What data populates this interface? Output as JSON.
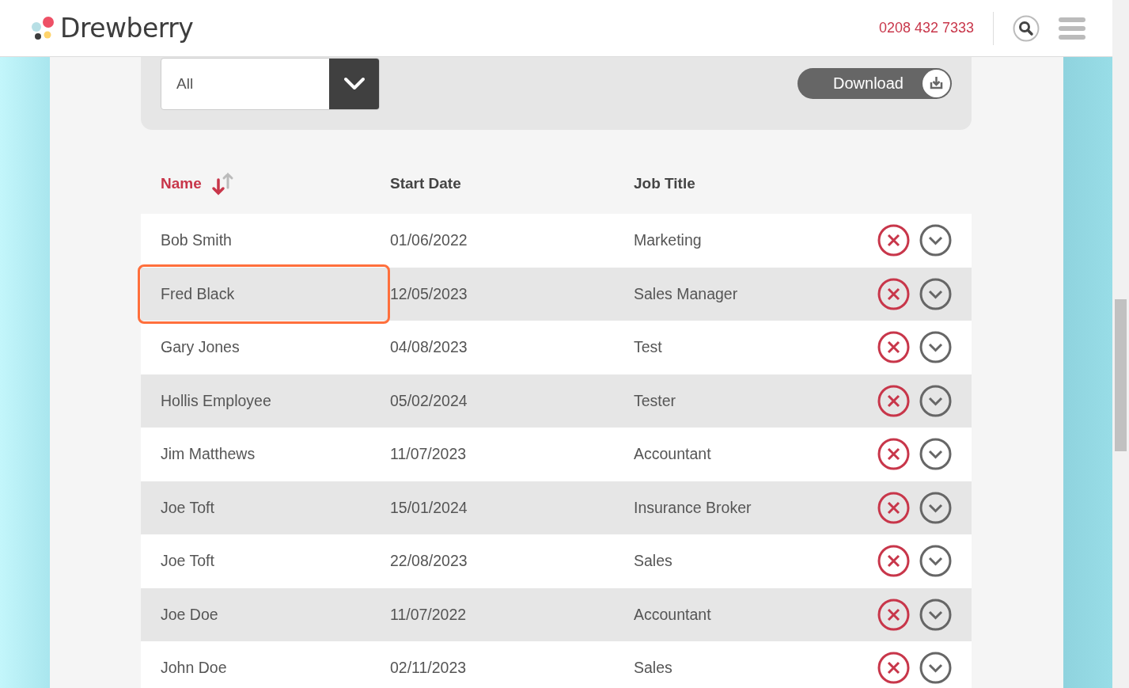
{
  "header": {
    "logo": "Drewberry",
    "phone": "0208 432 7333"
  },
  "filter": {
    "value": "All"
  },
  "download_button": {
    "label": "Download"
  },
  "table": {
    "columns": [
      {
        "label": "Name",
        "sorted": true
      },
      {
        "label": "Start Date",
        "sorted": false
      },
      {
        "label": "Job Title",
        "sorted": false
      }
    ],
    "rows": [
      {
        "name": "Bob Smith",
        "start_date": "01/06/2022",
        "job_title": "Marketing",
        "highlighted": false
      },
      {
        "name": "Fred Black",
        "start_date": "12/05/2023",
        "job_title": "Sales Manager",
        "highlighted": true
      },
      {
        "name": "Gary Jones",
        "start_date": "04/08/2023",
        "job_title": "Test",
        "highlighted": false
      },
      {
        "name": "Hollis Employee",
        "start_date": "05/02/2024",
        "job_title": "Tester",
        "highlighted": false
      },
      {
        "name": "Jim Matthews",
        "start_date": "11/07/2023",
        "job_title": "Accountant",
        "highlighted": false
      },
      {
        "name": "Joe Toft",
        "start_date": "15/01/2024",
        "job_title": "Insurance Broker",
        "highlighted": false
      },
      {
        "name": "Joe Toft",
        "start_date": "22/08/2023",
        "job_title": "Sales",
        "highlighted": false
      },
      {
        "name": "Joe Doe",
        "start_date": "11/07/2022",
        "job_title": "Accountant",
        "highlighted": false
      },
      {
        "name": "John Doe",
        "start_date": "02/11/2023",
        "job_title": "Sales",
        "highlighted": false
      }
    ]
  }
}
